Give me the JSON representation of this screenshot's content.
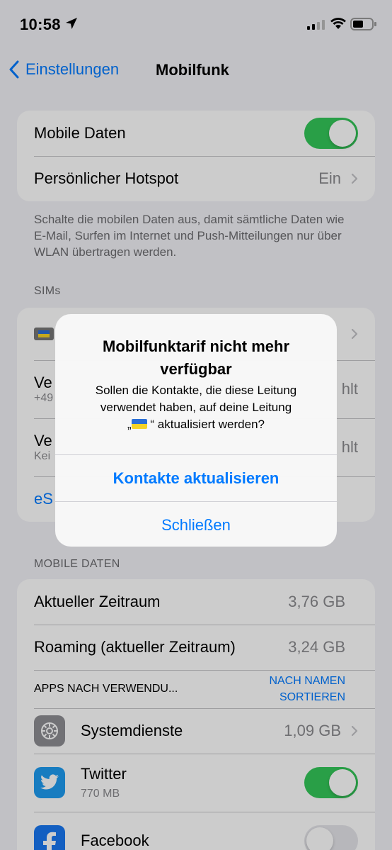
{
  "status_bar": {
    "time": "10:58"
  },
  "nav": {
    "back_label": "Einstellungen",
    "title": "Mobilfunk"
  },
  "group1": {
    "mobile_data_label": "Mobile Daten",
    "hotspot_label": "Persönlicher Hotspot",
    "hotspot_value": "Ein"
  },
  "mobile_data_footer": "Schalte die mobilen Daten aus, damit sämtliche Daten wie E-Mail, Surfen im Internet und Push-Mitteilungen nur über WLAN übertragen werden.",
  "sims": {
    "header": "SIMs",
    "row2_title_partial": "Ve",
    "row2_sub_partial": "+49",
    "row2_value_partial": "hlt",
    "row3_title_partial": "Ve",
    "row3_sub_partial": "Kei",
    "row3_value_partial": "hlt",
    "row4_partial": "eS"
  },
  "mobile_data_section": {
    "header": "MOBILE DATEN",
    "current_period_label": "Aktueller Zeitraum",
    "current_period_value": "3,76 GB",
    "roaming_label": "Roaming (aktueller Zeitraum)",
    "roaming_value": "3,24 GB",
    "apps_header": "APPS NACH VERWENDU...",
    "sort_button": "NACH NAMEN SORTIEREN"
  },
  "apps": [
    {
      "name": "Systemdienste",
      "value": "1,09 GB",
      "icon": "gear-icon"
    },
    {
      "name": "Twitter",
      "sub": "770 MB",
      "icon": "twitter-icon",
      "enabled": true
    },
    {
      "name": "Facebook",
      "icon": "facebook-icon",
      "enabled": false
    }
  ],
  "alert": {
    "title": "Mobilfunktarif nicht mehr verfügbar",
    "message_part1": "Sollen die Kontakte, die diese Leitung verwendet haben, auf deine Leitung",
    "message_quote_open": "„",
    "message_quote_close": "“ aktualisiert werden?",
    "primary_button": "Kontakte aktualisieren",
    "close_button": "Schließen"
  },
  "colors": {
    "accent": "#007aff",
    "toggle_on": "#34c759",
    "background": "#f2f2f7",
    "twitter": "#1d9bf0",
    "facebook": "#1877f2",
    "system_services": "#8e8e93"
  }
}
